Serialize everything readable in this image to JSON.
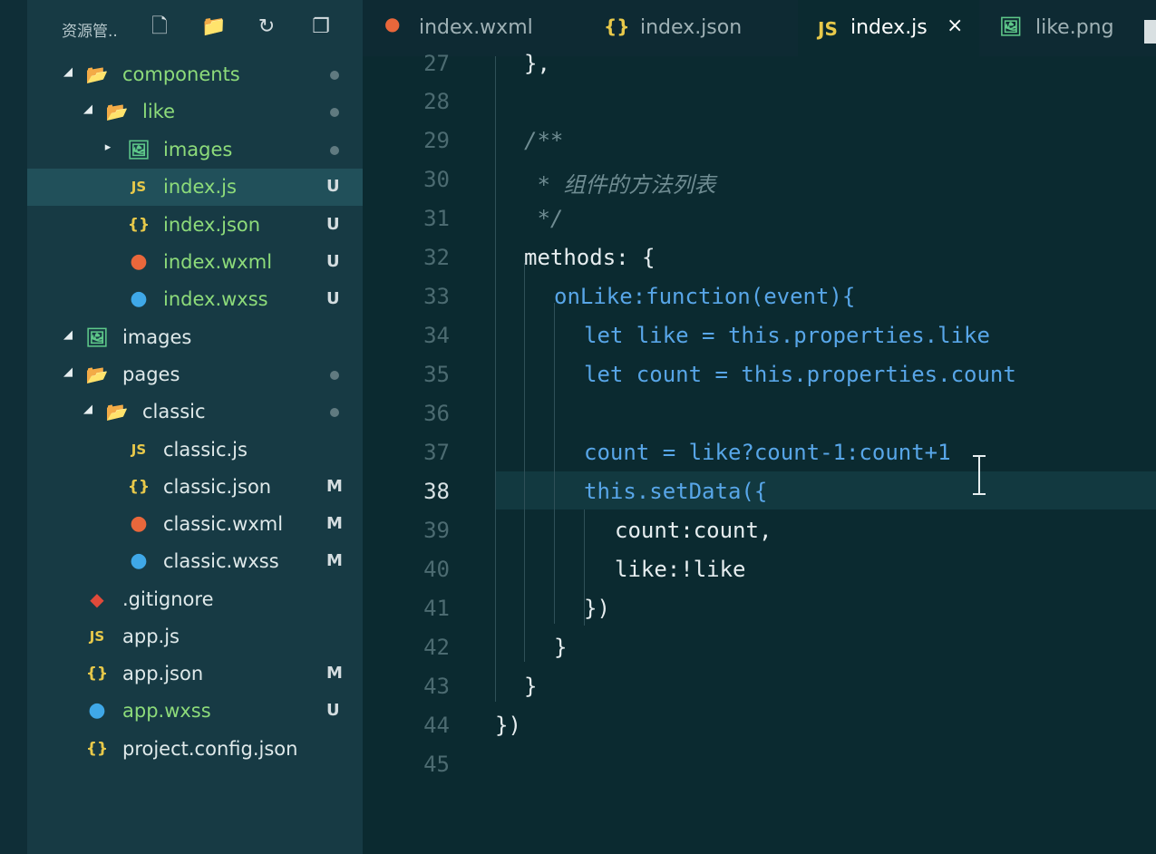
{
  "sidebar": {
    "title": "资源管..",
    "tree": [
      {
        "label": "components",
        "type": "folder",
        "expanded": true,
        "status": "dot",
        "color": "green"
      },
      {
        "label": "like",
        "type": "folder",
        "expanded": true,
        "status": "dot",
        "color": "green"
      },
      {
        "label": "images",
        "type": "image-folder",
        "expanded": false,
        "status": "dot",
        "color": "green"
      },
      {
        "label": "index.js",
        "type": "js",
        "status": "U",
        "color": "green",
        "selected": true
      },
      {
        "label": "index.json",
        "type": "json",
        "status": "U",
        "color": "green"
      },
      {
        "label": "index.wxml",
        "type": "wxml",
        "status": "U",
        "color": "green"
      },
      {
        "label": "index.wxss",
        "type": "wxss",
        "status": "U",
        "color": "green"
      },
      {
        "label": "images",
        "type": "image-folder",
        "expanded": true,
        "status": "",
        "color": "white"
      },
      {
        "label": "pages",
        "type": "folder",
        "expanded": true,
        "status": "dot",
        "color": "white"
      },
      {
        "label": "classic",
        "type": "folder",
        "expanded": true,
        "status": "dot",
        "color": "white"
      },
      {
        "label": "classic.js",
        "type": "js",
        "status": "",
        "color": "white"
      },
      {
        "label": "classic.json",
        "type": "json",
        "status": "M",
        "color": "white"
      },
      {
        "label": "classic.wxml",
        "type": "wxml",
        "status": "M",
        "color": "white"
      },
      {
        "label": "classic.wxss",
        "type": "wxss",
        "status": "M",
        "color": "white"
      },
      {
        "label": ".gitignore",
        "type": "git",
        "status": "",
        "color": "white"
      },
      {
        "label": "app.js",
        "type": "js",
        "status": "",
        "color": "white"
      },
      {
        "label": "app.json",
        "type": "json",
        "status": "M",
        "color": "white"
      },
      {
        "label": "app.wxss",
        "type": "wxss",
        "status": "U",
        "color": "green"
      },
      {
        "label": "project.config.json",
        "type": "json",
        "status": "",
        "color": "white"
      }
    ]
  },
  "tabs": [
    {
      "label": "index.wxml",
      "icon": "wxml-icon",
      "active": false
    },
    {
      "label": "index.json",
      "icon": "json-icon",
      "active": false
    },
    {
      "label": "index.js",
      "icon": "js-icon",
      "active": true,
      "close": "×"
    },
    {
      "label": "like.png",
      "icon": "image-icon",
      "active": false
    }
  ],
  "editor": {
    "current_line": 38,
    "lines": [
      {
        "n": "27",
        "code": "},"
      },
      {
        "n": "28",
        "code": ""
      },
      {
        "n": "29",
        "code": "/**"
      },
      {
        "n": "30",
        "code": " * 组件的方法列表"
      },
      {
        "n": "31",
        "code": " */"
      },
      {
        "n": "32",
        "code": "methods: {"
      },
      {
        "n": "33",
        "code": "onLike:function(event){"
      },
      {
        "n": "34",
        "code": "let like = this.properties.like"
      },
      {
        "n": "35",
        "code": "let count = this.properties.count"
      },
      {
        "n": "36",
        "code": ""
      },
      {
        "n": "37",
        "code": "count = like?count-1:count+1"
      },
      {
        "n": "38",
        "code": "this.setData({"
      },
      {
        "n": "39",
        "code": "count:count,"
      },
      {
        "n": "40",
        "code": "like:!like"
      },
      {
        "n": "41",
        "code": "})"
      },
      {
        "n": "42",
        "code": "}"
      },
      {
        "n": "43",
        "code": "}"
      },
      {
        "n": "44",
        "code": "})"
      },
      {
        "n": "45",
        "code": ""
      }
    ]
  },
  "colors": {
    "background": "#0b2a30",
    "sidebar": "#173a44",
    "keyword_blue": "#58a6e8",
    "number_pink": "#e85d8a",
    "folder_green": "#8ddb7a"
  }
}
